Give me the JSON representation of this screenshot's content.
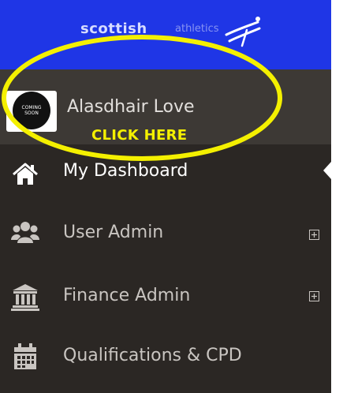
{
  "brand": {
    "name_bold": "scottish",
    "name_light": "athletics",
    "bg_color": "#1f36e6"
  },
  "user": {
    "name": "Alasdhair Love",
    "avatar_text_line1": "COMING",
    "avatar_text_line2": "SOON"
  },
  "annotation": {
    "text": "CLICK HERE",
    "color": "#f4f000"
  },
  "nav": {
    "items": [
      {
        "label": "My Dashboard",
        "icon": "home-icon",
        "active": true,
        "expandable": false
      },
      {
        "label": "User Admin",
        "icon": "users-icon",
        "active": false,
        "expandable": true
      },
      {
        "label": "Finance Admin",
        "icon": "bank-icon",
        "active": false,
        "expandable": true
      },
      {
        "label": "Qualifications & CPD",
        "icon": "calendar-icon",
        "active": false,
        "expandable": false
      }
    ]
  },
  "colors": {
    "sidebar_bg": "#2b2724",
    "user_row_bg": "#3d3935",
    "nav_text": "#c9c5c1",
    "active_text": "#ffffff"
  }
}
